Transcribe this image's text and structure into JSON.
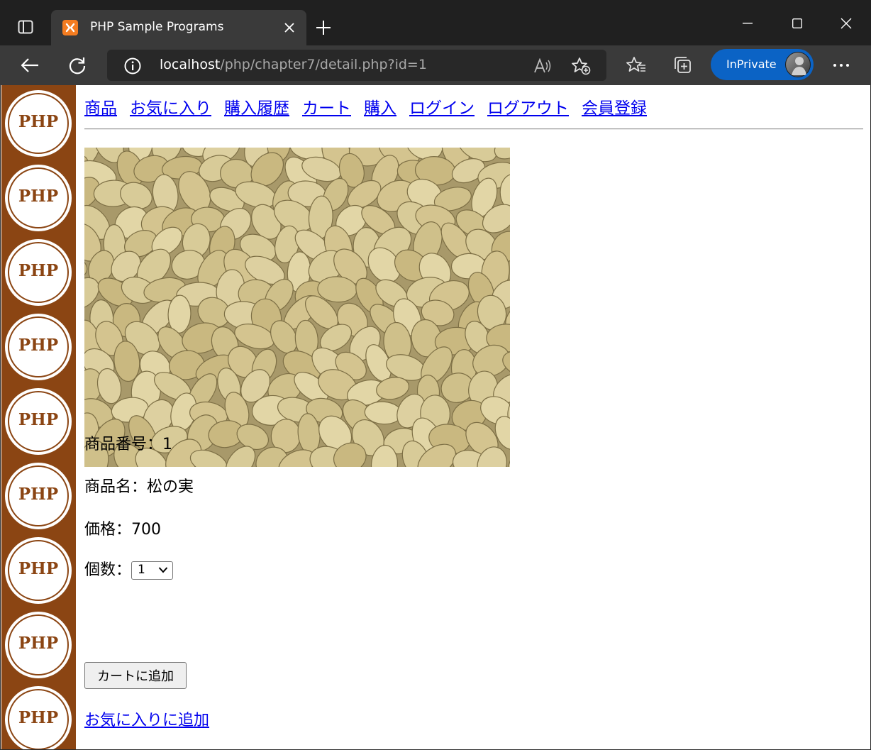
{
  "browser": {
    "tab_title": "PHP Sample Programs",
    "url_host": "localhost",
    "url_path": "/php/chapter7/detail.php?id=1",
    "inprivate_label": "InPrivate",
    "accent_color": "#0b63c5"
  },
  "sidebar": {
    "logo_text": "PHP",
    "background_color": "#8b4513"
  },
  "nav": {
    "links": [
      "商品",
      "お気に入り",
      "購入履歴",
      "カート",
      "購入",
      "ログイン",
      "ログアウト",
      "会員登録"
    ]
  },
  "product": {
    "image_alt": "松の実",
    "id_label": "商品番号：",
    "id_value": "1",
    "name_label": "商品名：",
    "name_value": "松の実",
    "price_label": "価格：",
    "price_value": "700",
    "qty_label": "個数：",
    "qty_selected": "1"
  },
  "actions": {
    "add_to_cart": "カートに追加",
    "add_to_favorites": "お気に入りに追加"
  }
}
